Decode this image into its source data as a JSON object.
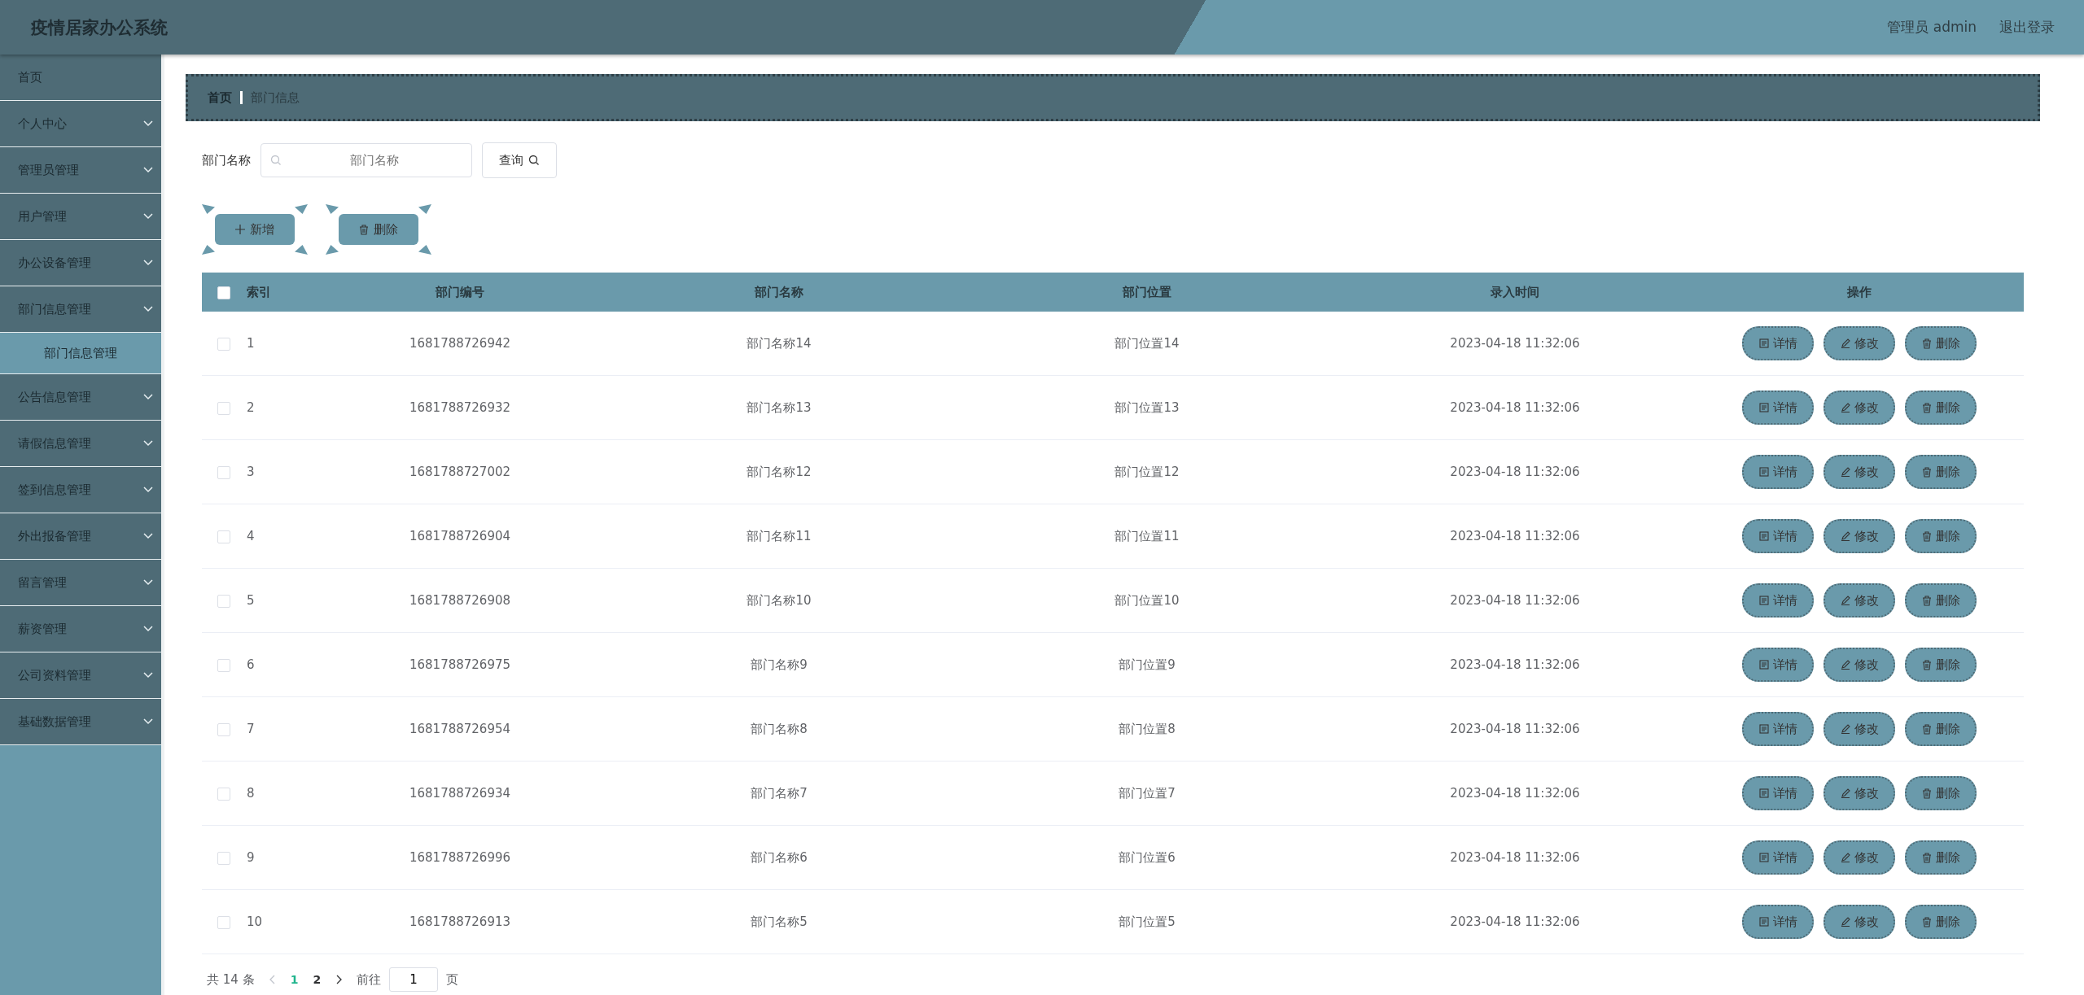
{
  "header": {
    "title": "疫情居家办公系统",
    "user": "管理员 admin",
    "logout": "退出登录"
  },
  "sidebar": {
    "items": [
      {
        "label": "首页",
        "kind": "link"
      },
      {
        "label": "个人中心",
        "kind": "menu"
      },
      {
        "label": "管理员管理",
        "kind": "menu"
      },
      {
        "label": "用户管理",
        "kind": "menu"
      },
      {
        "label": "办公设备管理",
        "kind": "menu"
      },
      {
        "label": "部门信息管理",
        "kind": "menu",
        "children": [
          {
            "label": "部门信息管理",
            "selected": true
          }
        ]
      },
      {
        "label": "公告信息管理",
        "kind": "menu"
      },
      {
        "label": "请假信息管理",
        "kind": "menu"
      },
      {
        "label": "签到信息管理",
        "kind": "menu"
      },
      {
        "label": "外出报备管理",
        "kind": "menu"
      },
      {
        "label": "留言管理",
        "kind": "menu"
      },
      {
        "label": "薪资管理",
        "kind": "menu"
      },
      {
        "label": "公司资料管理",
        "kind": "menu"
      },
      {
        "label": "基础数据管理",
        "kind": "menu"
      }
    ]
  },
  "breadcrumb": [
    "首页",
    "部门信息"
  ],
  "search": {
    "label": "部门名称",
    "placeholder": "部门名称",
    "button": "查询"
  },
  "actions": [
    {
      "kind": "add",
      "label": "新增"
    },
    {
      "kind": "delete",
      "label": "删除"
    }
  ],
  "table": {
    "select_all": false,
    "columns": [
      "索引",
      "部门编号",
      "部门名称",
      "部门位置",
      "录入时间",
      "操作"
    ],
    "rows": [
      {
        "checked": false,
        "index": "1",
        "code": "1681788726942",
        "name": "部门名称14",
        "location": "部门位置14",
        "time": "2023-04-18 11:32:06",
        "actions": [
          {
            "kind": "detail",
            "label": "详情"
          },
          {
            "kind": "edit",
            "label": "修改"
          },
          {
            "kind": "delete",
            "label": "删除"
          }
        ]
      },
      {
        "checked": false,
        "index": "2",
        "code": "1681788726932",
        "name": "部门名称13",
        "location": "部门位置13",
        "time": "2023-04-18 11:32:06",
        "actions": [
          {
            "kind": "detail",
            "label": "详情"
          },
          {
            "kind": "edit",
            "label": "修改"
          },
          {
            "kind": "delete",
            "label": "删除"
          }
        ]
      },
      {
        "checked": false,
        "index": "3",
        "code": "1681788727002",
        "name": "部门名称12",
        "location": "部门位置12",
        "time": "2023-04-18 11:32:06",
        "actions": [
          {
            "kind": "detail",
            "label": "详情"
          },
          {
            "kind": "edit",
            "label": "修改"
          },
          {
            "kind": "delete",
            "label": "删除"
          }
        ]
      },
      {
        "checked": false,
        "index": "4",
        "code": "1681788726904",
        "name": "部门名称11",
        "location": "部门位置11",
        "time": "2023-04-18 11:32:06",
        "actions": [
          {
            "kind": "detail",
            "label": "详情"
          },
          {
            "kind": "edit",
            "label": "修改"
          },
          {
            "kind": "delete",
            "label": "删除"
          }
        ]
      },
      {
        "checked": false,
        "index": "5",
        "code": "1681788726908",
        "name": "部门名称10",
        "location": "部门位置10",
        "time": "2023-04-18 11:32:06",
        "actions": [
          {
            "kind": "detail",
            "label": "详情"
          },
          {
            "kind": "edit",
            "label": "修改"
          },
          {
            "kind": "delete",
            "label": "删除"
          }
        ]
      },
      {
        "checked": false,
        "index": "6",
        "code": "1681788726975",
        "name": "部门名称9",
        "location": "部门位置9",
        "time": "2023-04-18 11:32:06",
        "actions": [
          {
            "kind": "detail",
            "label": "详情"
          },
          {
            "kind": "edit",
            "label": "修改"
          },
          {
            "kind": "delete",
            "label": "删除"
          }
        ]
      },
      {
        "checked": false,
        "index": "7",
        "code": "1681788726954",
        "name": "部门名称8",
        "location": "部门位置8",
        "time": "2023-04-18 11:32:06",
        "actions": [
          {
            "kind": "detail",
            "label": "详情"
          },
          {
            "kind": "edit",
            "label": "修改"
          },
          {
            "kind": "delete",
            "label": "删除"
          }
        ]
      },
      {
        "checked": false,
        "index": "8",
        "code": "1681788726934",
        "name": "部门名称7",
        "location": "部门位置7",
        "time": "2023-04-18 11:32:06",
        "actions": [
          {
            "kind": "detail",
            "label": "详情"
          },
          {
            "kind": "edit",
            "label": "修改"
          },
          {
            "kind": "delete",
            "label": "删除"
          }
        ]
      },
      {
        "checked": false,
        "index": "9",
        "code": "1681788726996",
        "name": "部门名称6",
        "location": "部门位置6",
        "time": "2023-04-18 11:32:06",
        "actions": [
          {
            "kind": "detail",
            "label": "详情"
          },
          {
            "kind": "edit",
            "label": "修改"
          },
          {
            "kind": "delete",
            "label": "删除"
          }
        ]
      },
      {
        "checked": false,
        "index": "10",
        "code": "1681788726913",
        "name": "部门名称5",
        "location": "部门位置5",
        "time": "2023-04-18 11:32:06",
        "actions": [
          {
            "kind": "detail",
            "label": "详情"
          },
          {
            "kind": "edit",
            "label": "修改"
          },
          {
            "kind": "delete",
            "label": "删除"
          }
        ]
      }
    ]
  },
  "pagination": {
    "total": "共 14 条",
    "pages": [
      {
        "label": "1",
        "selected": true
      },
      {
        "label": "2",
        "selected": false
      }
    ],
    "goto_label": "前往",
    "goto_value": "1",
    "goto_suffix": "页"
  }
}
